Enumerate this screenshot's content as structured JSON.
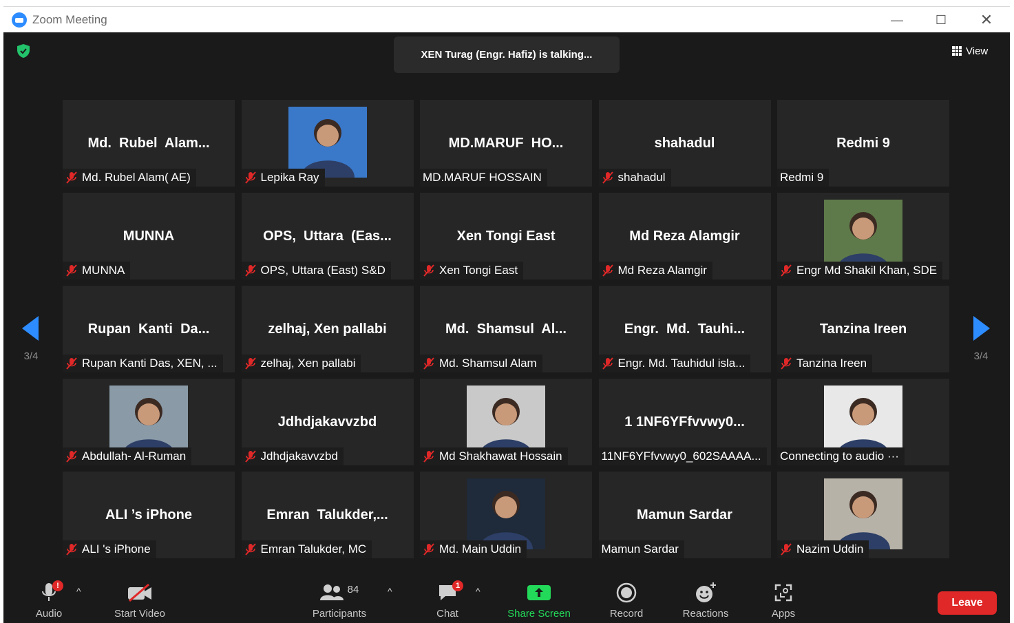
{
  "window": {
    "title": "Zoom Meeting",
    "minimize": "—",
    "maximize": "☐",
    "close": "✕"
  },
  "banner": {
    "talking": "XEN Turag (Engr. Hafiz) is talking..."
  },
  "view": {
    "label": "View"
  },
  "pager": {
    "left": "3/4",
    "right": "3/4"
  },
  "participants": [
    {
      "display": "Md.  Rubel  Alam...",
      "label": "Md. Rubel Alam( AE)",
      "muted": true,
      "video": false
    },
    {
      "display": "",
      "label": "Lepika Ray",
      "muted": true,
      "video": true
    },
    {
      "display": "MD.MARUF  HO...",
      "label": "MD.MARUF HOSSAIN",
      "muted": false,
      "video": false
    },
    {
      "display": "shahadul",
      "label": "shahadul",
      "muted": true,
      "video": false
    },
    {
      "display": "Redmi 9",
      "label": "Redmi 9",
      "muted": false,
      "video": false
    },
    {
      "display": "MUNNA",
      "label": "MUNNA",
      "muted": true,
      "video": false
    },
    {
      "display": "OPS,  Uttara  (Eas...",
      "label": "OPS, Uttara (East) S&D",
      "muted": true,
      "video": false
    },
    {
      "display": "Xen Tongi East",
      "label": "Xen Tongi East",
      "muted": true,
      "video": false
    },
    {
      "display": "Md Reza Alamgir",
      "label": "Md Reza Alamgir",
      "muted": true,
      "video": false
    },
    {
      "display": "",
      "label": "Engr Md Shakil Khan, SDE",
      "muted": true,
      "video": true
    },
    {
      "display": "Rupan  Kanti  Da...",
      "label": "Rupan Kanti Das, XEN, ...",
      "muted": true,
      "video": false
    },
    {
      "display": "zelhaj, Xen pallabi",
      "label": "zelhaj, Xen pallabi",
      "muted": true,
      "video": false
    },
    {
      "display": "Md.  Shamsul  Al...",
      "label": "Md. Shamsul Alam",
      "muted": true,
      "video": false
    },
    {
      "display": "Engr.  Md.  Tauhi...",
      "label": "Engr. Md. Tauhidul isla...",
      "muted": true,
      "video": false
    },
    {
      "display": "Tanzina Ireen",
      "label": "Tanzina Ireen",
      "muted": true,
      "video": false
    },
    {
      "display": "",
      "label": "Abdullah- Al-Ruman",
      "muted": true,
      "video": true
    },
    {
      "display": "Jdhdjakavvzbd",
      "label": "Jdhdjakavvzbd",
      "muted": true,
      "video": false
    },
    {
      "display": "",
      "label": "Md Shakhawat Hossain",
      "muted": true,
      "video": true
    },
    {
      "display": "1 1NF6YFfvvwy0...",
      "label": "11NF6YFfvvwy0_602SAAAA...",
      "muted": false,
      "video": false
    },
    {
      "display": "",
      "label": "Connecting to audio ···",
      "muted": false,
      "video": true
    },
    {
      "display": "ALI ’s iPhone",
      "label": "ALI 's iPhone",
      "muted": true,
      "video": false
    },
    {
      "display": "Emran  Talukder,...",
      "label": "Emran Talukder, MC",
      "muted": true,
      "video": false
    },
    {
      "display": "",
      "label": "Md. Main Uddin",
      "muted": true,
      "video": true
    },
    {
      "display": "Mamun Sardar",
      "label": "Mamun Sardar",
      "muted": false,
      "video": false
    },
    {
      "display": "",
      "label": "Nazim Uddin",
      "muted": true,
      "video": true
    }
  ],
  "toolbar": {
    "audio": "Audio",
    "audio_badge": "!",
    "start_video": "Start Video",
    "participants": "Participants",
    "participants_count": "84",
    "chat": "Chat",
    "chat_badge": "1",
    "share_screen": "Share Screen",
    "record": "Record",
    "reactions": "Reactions",
    "apps": "Apps",
    "leave": "Leave"
  },
  "colors": {
    "background": "#1a1a1a",
    "tile": "#262626",
    "share_green": "#23d959",
    "leave_red": "#e02828",
    "pager_blue": "#2d8cff",
    "mute_red": "#e02828"
  }
}
